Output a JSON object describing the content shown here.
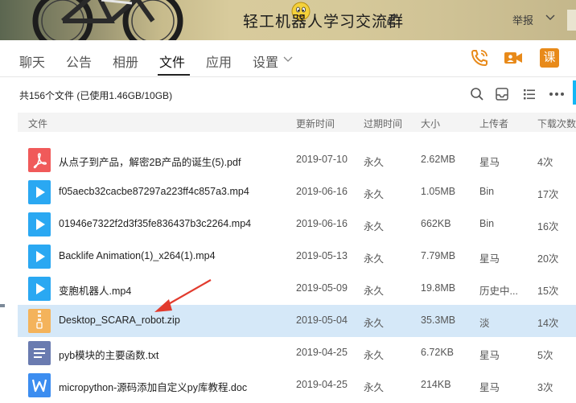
{
  "header": {
    "title": "轻工机器人学习交流群",
    "report_label": "举报"
  },
  "tabs": [
    {
      "label": "聊天"
    },
    {
      "label": "公告"
    },
    {
      "label": "相册"
    },
    {
      "label": "文件",
      "active": true
    },
    {
      "label": "应用"
    },
    {
      "label": "设置"
    }
  ],
  "actions": {
    "lesson_label": "课"
  },
  "summary": {
    "text": "共156个文件 (已使用1.46GB/10GB)"
  },
  "columns": {
    "file": "文件",
    "updated": "更新时间",
    "expires": "过期时间",
    "size": "大小",
    "uploader": "上传者",
    "downloads": "下载次数"
  },
  "files": [
    {
      "name": "从点子到产品，解密2B产品的诞生(5).pdf",
      "date": "2019-07-10",
      "expires": "永久",
      "size": "2.62MB",
      "uploader": "星马",
      "downloads": "4次",
      "icon": "pdf-icon",
      "color": "#f05a5a"
    },
    {
      "name": "f05aecb32cacbe87297a223ff4c857a3.mp4",
      "date": "2019-06-16",
      "expires": "永久",
      "size": "1.05MB",
      "uploader": "Bin",
      "downloads": "17次",
      "icon": "video-icon",
      "color": "#2aa8f2"
    },
    {
      "name": "01946e7322f2d3f35fe836437b3c2264.mp4",
      "date": "2019-06-16",
      "expires": "永久",
      "size": "662KB",
      "uploader": "Bin",
      "downloads": "16次",
      "icon": "video-icon",
      "color": "#2aa8f2"
    },
    {
      "name": "Backlife Animation(1)_x264(1).mp4",
      "date": "2019-05-13",
      "expires": "永久",
      "size": "7.79MB",
      "uploader": "星马",
      "downloads": "20次",
      "icon": "video-icon",
      "color": "#2aa8f2"
    },
    {
      "name": "变胞机器人.mp4",
      "date": "2019-05-09",
      "expires": "永久",
      "size": "19.8MB",
      "uploader": "历史中...",
      "downloads": "15次",
      "icon": "video-icon",
      "color": "#2aa8f2"
    },
    {
      "name": "Desktop_SCARA_robot.zip",
      "date": "2019-05-04",
      "expires": "永久",
      "size": "35.3MB",
      "uploader": "淡",
      "downloads": "14次",
      "icon": "zip-icon",
      "color": "#f4b35b",
      "selected": true
    },
    {
      "name": "pyb模块的主要函数.txt",
      "date": "2019-04-25",
      "expires": "永久",
      "size": "6.72KB",
      "uploader": "星马",
      "downloads": "5次",
      "icon": "txt-icon",
      "color": "#6a7bb0"
    },
    {
      "name": "micropython-源码添加自定义py库教程.doc",
      "date": "2019-04-25",
      "expires": "永久",
      "size": "214KB",
      "uploader": "星马",
      "downloads": "3次",
      "icon": "doc-icon",
      "color": "#3c8df0"
    }
  ],
  "colors": {
    "accent": "#e88a1a",
    "selected_row": "#d5e8f8",
    "arrow": "#e23b2e"
  }
}
